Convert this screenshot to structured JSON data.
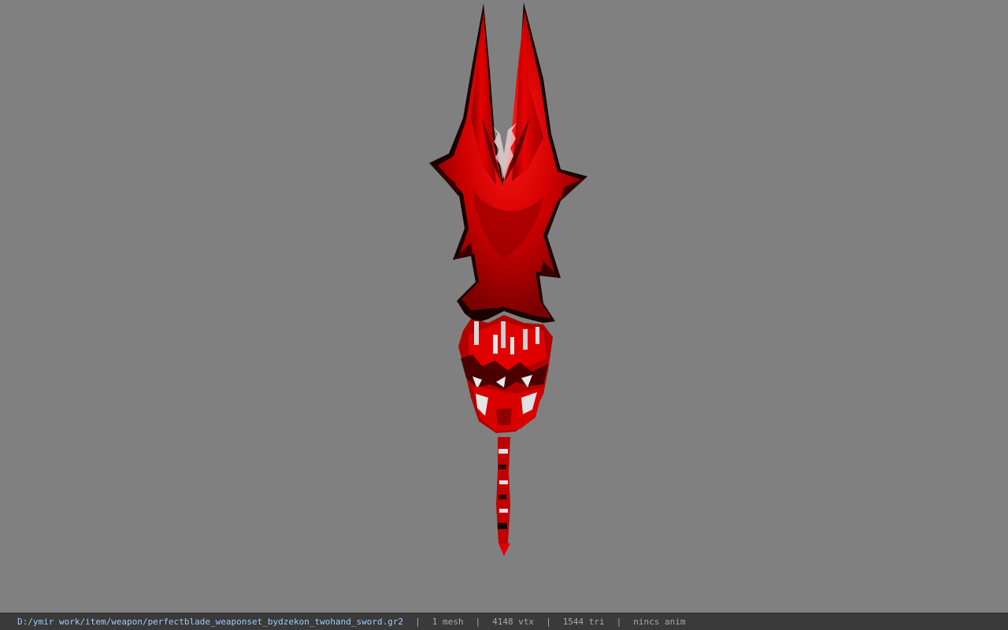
{
  "viewport": {
    "background": "#808080",
    "model": {
      "name": "two-hand sword",
      "primary_color": "#e00000",
      "shadow_color": "#5a0000",
      "outline_color": "#1a0000"
    }
  },
  "status_bar": {
    "file_path": "D:/ymir work/item/weapon/perfectblade_weaponset_bydzekon_twohand_sword.gr2",
    "separator": "|",
    "mesh_count": "1 mesh",
    "vertex_count": "4148 vtx",
    "triangle_count": "1544 tri",
    "anim_state": "nincs anim",
    "path_color": "#9ecbff",
    "text_color": "#a9a9a9"
  }
}
